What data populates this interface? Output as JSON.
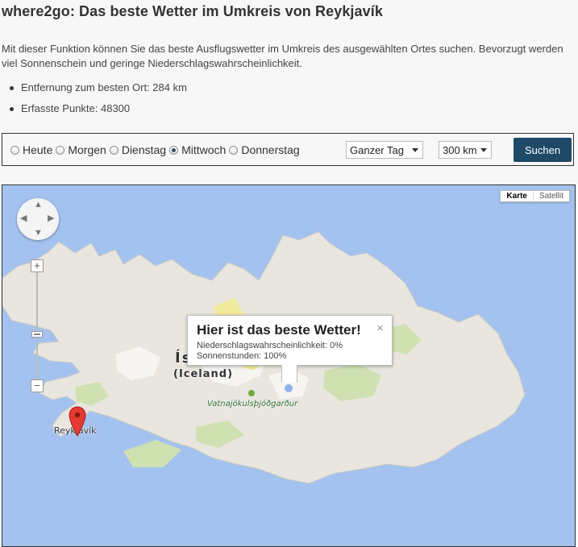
{
  "page": {
    "title": "where2go: Das beste Wetter im Umkreis von Reykjavík",
    "intro": "Mit dieser Funktion können Sie das beste Ausflugswetter im Umkreis des ausgewählten Ortes suchen. Bevorzugt werden viel Sonnenschein und geringe Niederschlagswahrscheinlichkeit.",
    "stats": [
      "Entfernung zum besten Ort: 284 km",
      "Erfasste Punkte: 48300"
    ]
  },
  "controls": {
    "days": [
      {
        "label": "Heute",
        "checked": false
      },
      {
        "label": "Morgen",
        "checked": false
      },
      {
        "label": "Dienstag",
        "checked": false
      },
      {
        "label": "Mittwoch",
        "checked": true
      },
      {
        "label": "Donnerstag",
        "checked": false
      }
    ],
    "timeframe": "Ganzer Tag",
    "radius": "300 km",
    "search_label": "Suchen"
  },
  "map": {
    "maptype_map": "Karte",
    "maptype_satellite": "Satellit",
    "zoom_in": "+",
    "zoom_out": "−",
    "label_island_partial": "Ís",
    "label_iceland": "(Iceland)",
    "label_park": "Vatnajökulsþjóðgarður",
    "label_city": "Reykjavík",
    "infowindow": {
      "title": "Hier ist das beste Wetter!",
      "line1": "Niederschlagswahrscheinlichkeit: 0%",
      "line2": "Sonnenstunden: 100%",
      "close": "×"
    },
    "colors": {
      "water": "#a3c2ef",
      "land": "#e9e6df",
      "green": "#cfe1b1",
      "highlight": "#f2ec8c",
      "marker": "#e53a33",
      "button": "#1e4a67"
    }
  }
}
